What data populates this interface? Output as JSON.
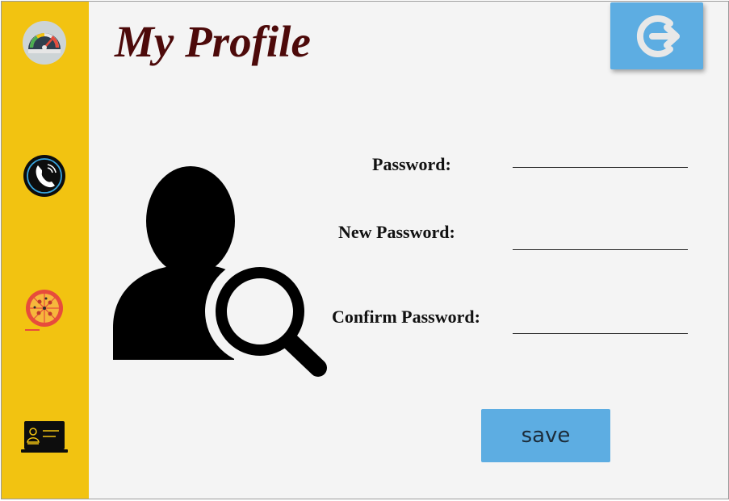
{
  "sidebar": {
    "items": [
      {
        "name": "dashboard",
        "icon": "speedometer-icon"
      },
      {
        "name": "contact",
        "icon": "phone-icon"
      },
      {
        "name": "menu",
        "icon": "pizza-icon"
      },
      {
        "name": "profile",
        "icon": "laptop-profile-icon"
      }
    ]
  },
  "header": {
    "title": "My Profile",
    "logout_icon": "logout-icon"
  },
  "form": {
    "password_label": "Password:",
    "password_value": "",
    "new_password_label": "New Password:",
    "new_password_value": "",
    "confirm_password_label": "Confirm Password:",
    "confirm_password_value": "",
    "save_label": "save"
  },
  "colors": {
    "sidebar": "#f2c311",
    "accent": "#5dade2",
    "title": "#4d0a0a",
    "background": "#f4f4f4"
  }
}
